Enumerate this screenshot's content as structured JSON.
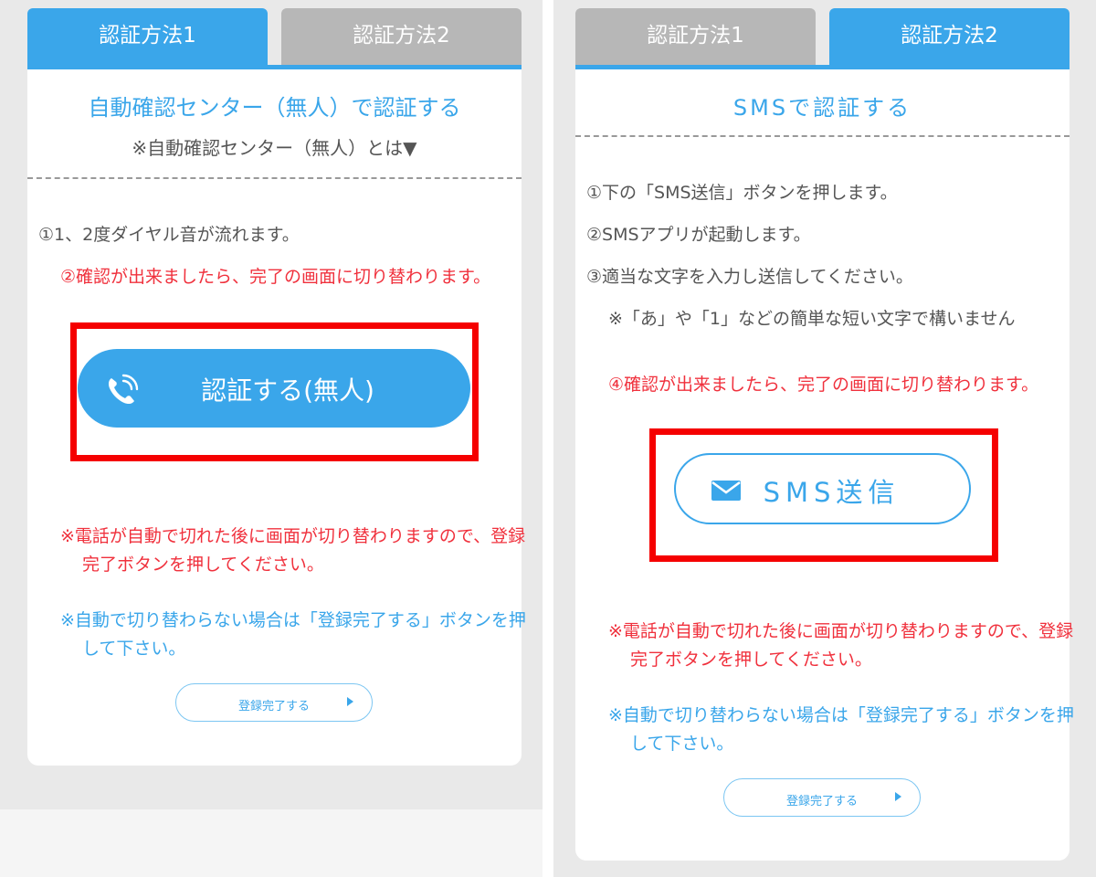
{
  "colors": {
    "accent": "#3aa6ea",
    "inactive_tab": "#b7b7b7",
    "warning": "#f0313d",
    "highlight": "#f50000"
  },
  "left": {
    "tabs": [
      {
        "label": "認証方法1",
        "active": true
      },
      {
        "label": "認証方法2",
        "active": false
      }
    ],
    "title": "自動確認センター（無人）で認証する",
    "subtitle": "※自動確認センター（無人）とは▼",
    "steps": [
      "①1、2度ダイヤル音が流れます。",
      "②確認が出来ましたら、完了の画面に切り替わります。"
    ],
    "call_button": {
      "label": "認証する(無人)",
      "icon": "phone-icon"
    },
    "note_red": "※電話が自動で切れた後に画面が切り替わりますので、登録完了ボタンを押してください。",
    "note_blue": "※自動で切り替わらない場合は「登録完了する」ボタンを押して下さい。",
    "done_button": "登録完了する"
  },
  "right": {
    "tabs": [
      {
        "label": "認証方法1",
        "active": false
      },
      {
        "label": "認証方法2",
        "active": true
      }
    ],
    "title": "SMSで認証する",
    "steps": [
      "①下の「SMS送信」ボタンを押します。",
      "②SMSアプリが起動します。",
      "③適当な文字を入力し送信してください。",
      "※「あ」や「1」などの簡単な短い文字で構いません",
      "④確認が出来ましたら、完了の画面に切り替わります。"
    ],
    "sms_button": {
      "label": "SMS送信",
      "icon": "envelope-icon"
    },
    "note_red": "※電話が自動で切れた後に画面が切り替わりますので、登録完了ボタンを押してください。",
    "note_blue": "※自動で切り替わらない場合は「登録完了する」ボタンを押して下さい。",
    "done_button": "登録完了する"
  }
}
